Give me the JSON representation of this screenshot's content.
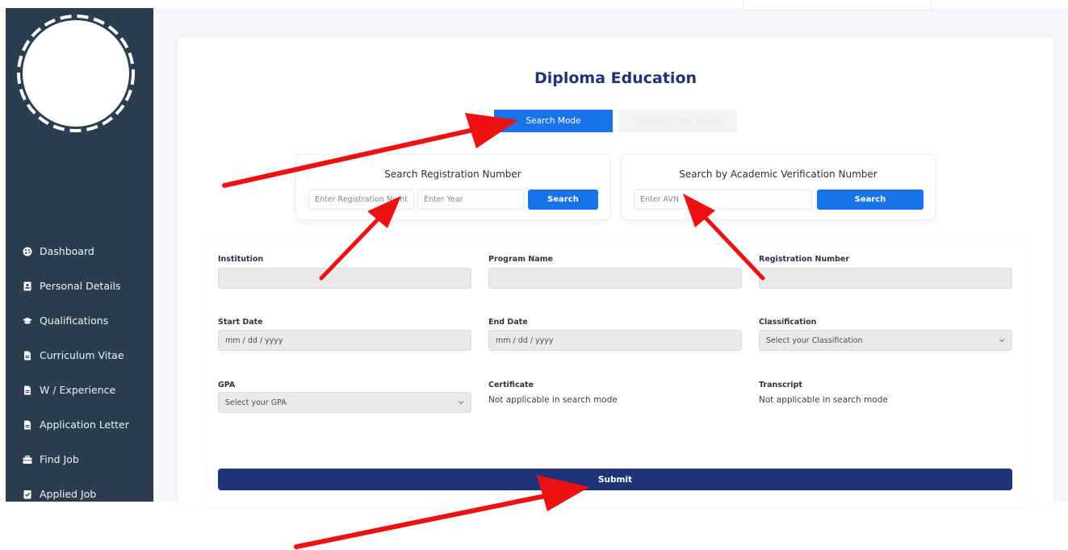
{
  "sidebar": {
    "items": [
      {
        "label": "Dashboard",
        "icon": "palette-icon"
      },
      {
        "label": "Personal Details",
        "icon": "id-card-icon"
      },
      {
        "label": "Qualifications",
        "icon": "graduation-cap-icon"
      },
      {
        "label": "Curriculum Vitae",
        "icon": "file-icon"
      },
      {
        "label": "W / Experience",
        "icon": "file-icon"
      },
      {
        "label": "Application Letter",
        "icon": "file-icon"
      },
      {
        "label": "Find Job",
        "icon": "briefcase-icon"
      },
      {
        "label": "Applied Job",
        "icon": "clipboard-check-icon"
      }
    ]
  },
  "main": {
    "title": "Diploma Education",
    "modes": {
      "search_label": "Search Mode",
      "manual_label": "Manual Entry Mode"
    },
    "search_registration": {
      "title": "Search Registration Number",
      "reg_placeholder": "Enter Registration Number",
      "year_placeholder": "Enter Year",
      "button_label": "Search"
    },
    "search_avn": {
      "title": "Search by Academic Verification Number",
      "avn_placeholder": "Enter AVN",
      "button_label": "Search"
    },
    "form": {
      "institution": {
        "label": "Institution",
        "value": ""
      },
      "program_name": {
        "label": "Program Name",
        "value": ""
      },
      "registration_number": {
        "label": "Registration Number",
        "value": ""
      },
      "start_date": {
        "label": "Start Date",
        "value": "mm / dd / yyyy"
      },
      "end_date": {
        "label": "End Date",
        "value": "mm / dd / yyyy"
      },
      "classification": {
        "label": "Classification",
        "value": "Select your Classification"
      },
      "gpa": {
        "label": "GPA",
        "value": "Select your GPA"
      },
      "certificate": {
        "label": "Certificate",
        "value": "Not applicable in search mode"
      },
      "transcript": {
        "label": "Transcript",
        "value": "Not applicable in search mode"
      },
      "submit_label": "Submit"
    }
  },
  "colors": {
    "sidebar_bg": "#2b3e50",
    "primary_blue": "#1a73e8",
    "navy": "#1f3378",
    "annotation_red": "#ee1111"
  }
}
